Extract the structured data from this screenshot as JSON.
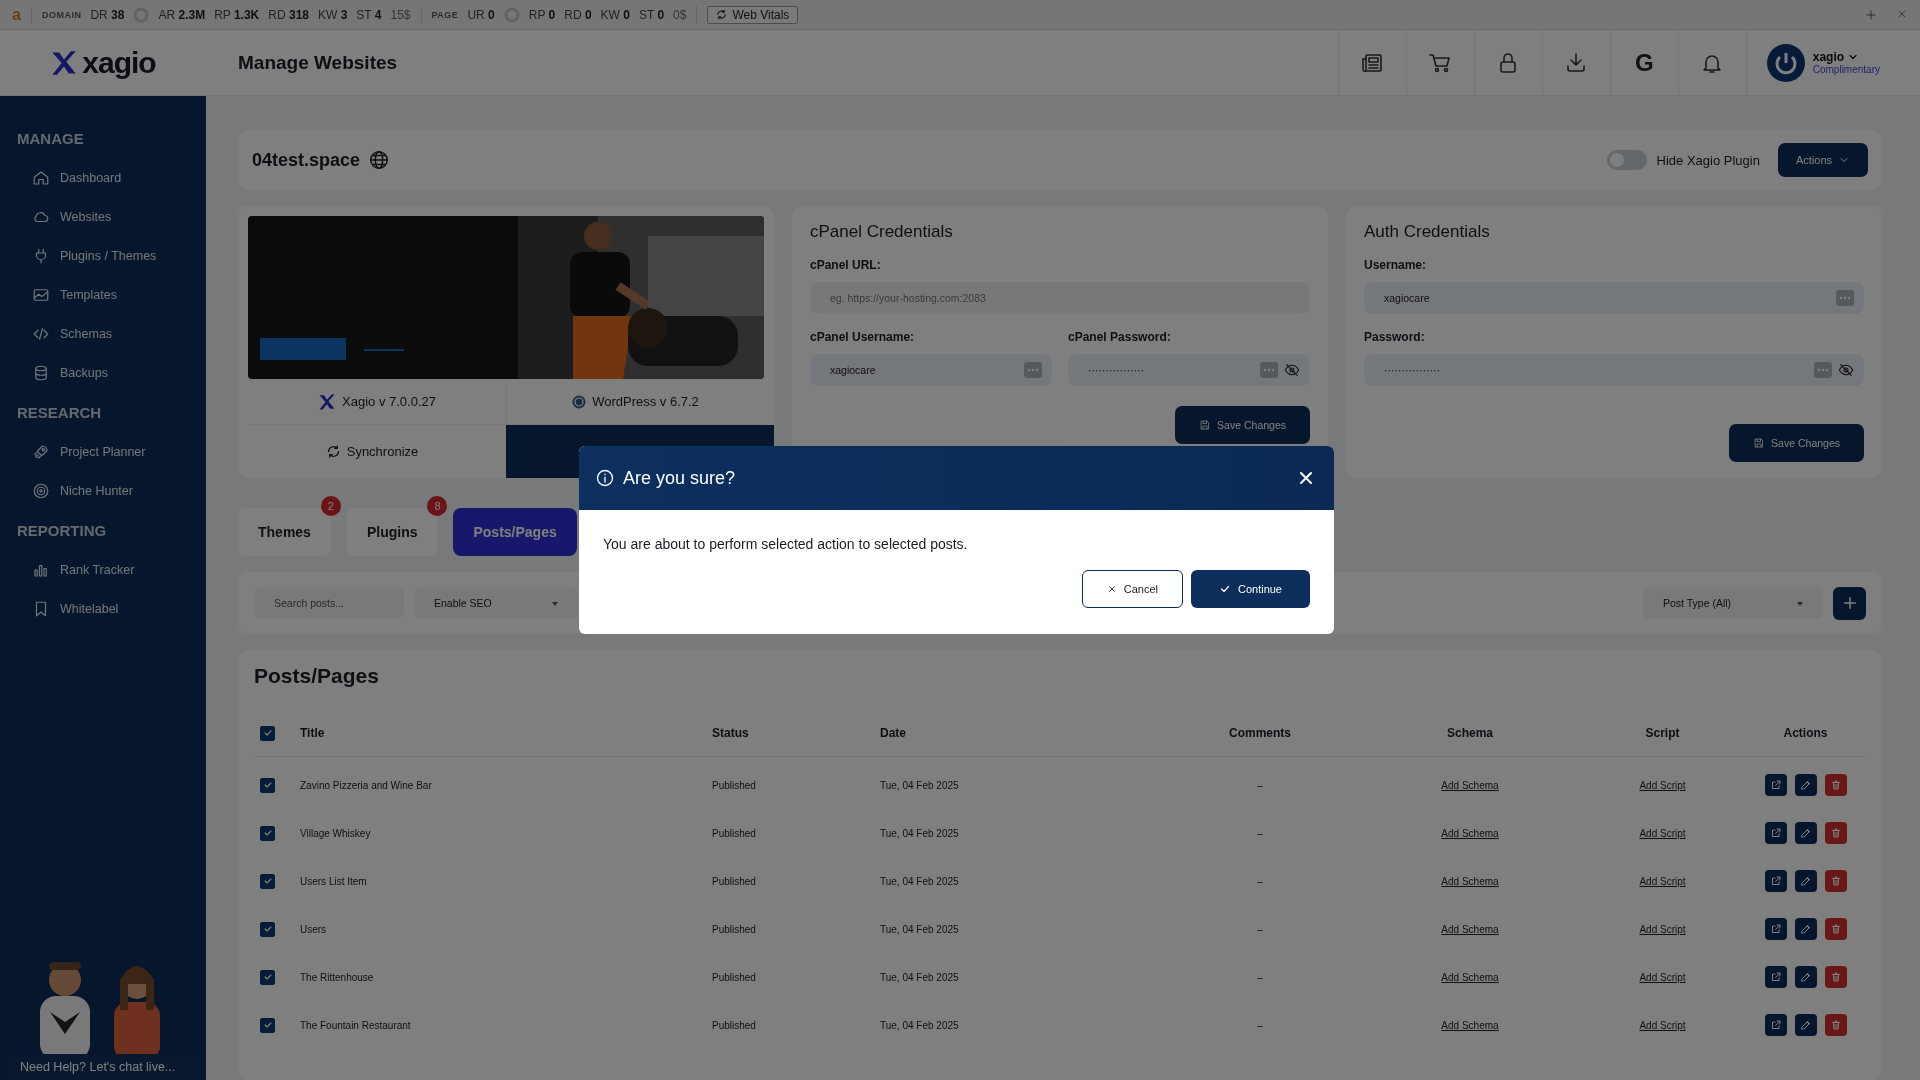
{
  "seo_bar": {
    "logo": "a",
    "groups": [
      {
        "label": "DOMAIN",
        "metrics": [
          {
            "kind": "metric",
            "label": "DR",
            "value": "38"
          },
          {
            "kind": "gauge"
          },
          {
            "kind": "metric",
            "label": "AR",
            "value": "2.3M"
          },
          {
            "kind": "metric",
            "label": "RP",
            "value": "1.3K"
          },
          {
            "kind": "metric",
            "label": "RD",
            "value": "318"
          },
          {
            "kind": "metric",
            "label": "KW",
            "value": "3"
          },
          {
            "kind": "metric",
            "label": "ST",
            "value": "4",
            "extra": "15$"
          }
        ]
      },
      {
        "label": "PAGE",
        "metrics": [
          {
            "kind": "metric",
            "label": "UR",
            "value": "0"
          },
          {
            "kind": "gauge"
          },
          {
            "kind": "metric",
            "label": "RP",
            "value": "0"
          },
          {
            "kind": "metric",
            "label": "RD",
            "value": "0"
          },
          {
            "kind": "metric",
            "label": "KW",
            "value": "0"
          },
          {
            "kind": "metric",
            "label": "ST",
            "value": "0",
            "extra": "0$"
          }
        ]
      }
    ],
    "button": "Web Vitals"
  },
  "header": {
    "brand": "xagio",
    "title": "Manage Websites",
    "icons": [
      {
        "kind": "news"
      },
      {
        "kind": "cart"
      },
      {
        "kind": "lock"
      },
      {
        "kind": "download"
      },
      {
        "kind": "google",
        "glyph": "G"
      },
      {
        "kind": "bell"
      }
    ],
    "user": {
      "name": "xagio",
      "plan": "Complimentary"
    }
  },
  "sidebar": {
    "sections": [
      {
        "heading": "MANAGE",
        "items": [
          {
            "label": "Dashboard"
          },
          {
            "label": "Websites"
          },
          {
            "label": "Plugins / Themes"
          },
          {
            "label": "Templates"
          },
          {
            "label": "Schemas"
          },
          {
            "label": "Backups"
          }
        ]
      },
      {
        "heading": "RESEARCH",
        "items": [
          {
            "label": "Project Planner"
          },
          {
            "label": "Niche Hunter"
          }
        ]
      },
      {
        "heading": "REPORTING",
        "items": [
          {
            "label": "Rank Tracker"
          },
          {
            "label": "Whitelabel"
          }
        ]
      }
    ],
    "help": "Need Help? Let's chat live..."
  },
  "website": {
    "domain": "04test.space",
    "hide_plugin": {
      "label": "Hide Xagio Plugin",
      "on": false
    },
    "actions": "Actions"
  },
  "site_card": {
    "xagio_version": "Xagio v 7.0.0.27",
    "wp_version": "WordPress v 6.7.2",
    "sync": "Synchronize"
  },
  "cpanel": {
    "title": "cPanel Credentials",
    "url": {
      "label": "cPanel URL:",
      "placeholder": "eg. https://your-hosting.com:2083"
    },
    "username": {
      "label": "cPanel Username:",
      "value": "xagiocare"
    },
    "password": {
      "label": "cPanel Password:",
      "value": "················"
    },
    "save": "Save Changes"
  },
  "auth": {
    "title": "Auth Credentials",
    "username": {
      "label": "Username:",
      "value": "xagiocare"
    },
    "password": {
      "label": "Password:",
      "value": "················"
    },
    "save": "Save Changes"
  },
  "tabs": [
    {
      "label": "Themes",
      "badge": "2",
      "selected": false
    },
    {
      "label": "Plugins",
      "badge": "8",
      "selected": false
    },
    {
      "label": "Posts/Pages",
      "selected": true
    }
  ],
  "filters": {
    "search": {
      "placeholder": "Search posts..."
    },
    "bulk_action": "Enable SEO",
    "post_type": "Post Type (All)"
  },
  "posts": {
    "title": "Posts/Pages",
    "select_all": true,
    "columns": [
      "Title",
      "Status",
      "Date",
      "Comments",
      "Schema",
      "Script",
      "Actions"
    ],
    "rows": [
      {
        "checked": true,
        "title": "Zavino Pizzeria and Wine Bar",
        "status": "Published",
        "date": "Tue, 04 Feb 2025",
        "comments": "–",
        "schema": "Add Schema",
        "script": "Add Script"
      },
      {
        "checked": true,
        "title": "Village Whiskey",
        "status": "Published",
        "date": "Tue, 04 Feb 2025",
        "comments": "–",
        "schema": "Add Schema",
        "script": "Add Script"
      },
      {
        "checked": true,
        "title": "Users List Item",
        "status": "Published",
        "date": "Tue, 04 Feb 2025",
        "comments": "–",
        "schema": "Add Schema",
        "script": "Add Script"
      },
      {
        "checked": true,
        "title": "Users",
        "status": "Published",
        "date": "Tue, 04 Feb 2025",
        "comments": "–",
        "schema": "Add Schema",
        "script": "Add Script"
      },
      {
        "checked": true,
        "title": "The Rittenhouse",
        "status": "Published",
        "date": "Tue, 04 Feb 2025",
        "comments": "–",
        "schema": "Add Schema",
        "script": "Add Script"
      },
      {
        "checked": true,
        "title": "The Fountain Restaurant",
        "status": "Published",
        "date": "Tue, 04 Feb 2025",
        "comments": "–",
        "schema": "Add Schema",
        "script": "Add Script"
      }
    ]
  },
  "modal": {
    "title": "Are you sure?",
    "message": "You are about to perform selected action to selected posts.",
    "cancel": "Cancel",
    "continue": "Continue"
  }
}
